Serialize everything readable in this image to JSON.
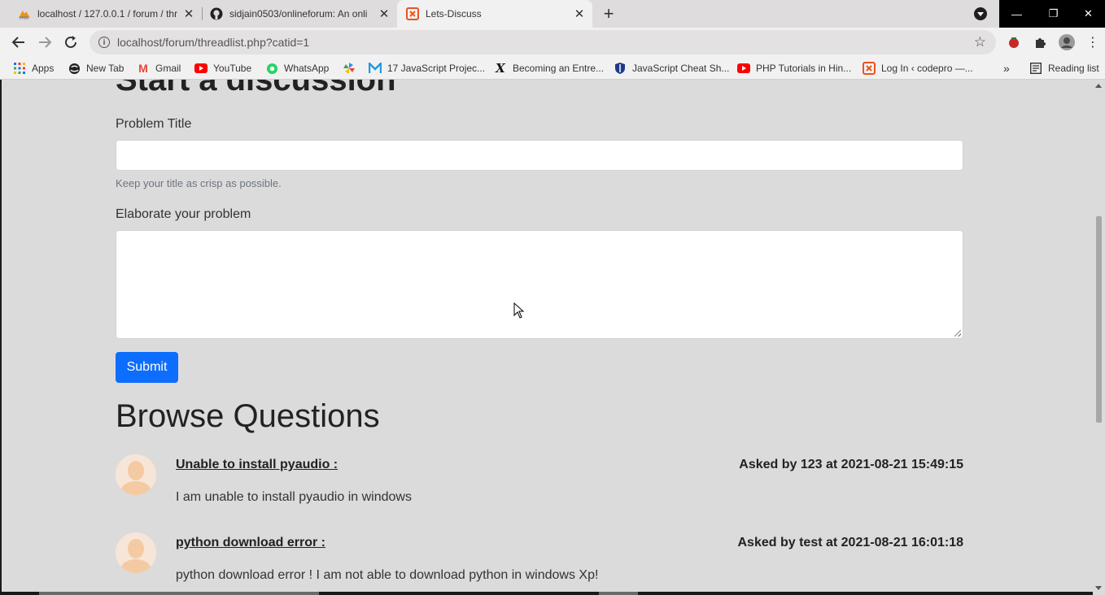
{
  "browser": {
    "tabs": [
      {
        "title": "localhost / 127.0.0.1 / forum / thr",
        "favicon": "phpmyadmin-icon",
        "active": false
      },
      {
        "title": "sidjain0503/onlineforum: An onli",
        "favicon": "github-icon",
        "active": false
      },
      {
        "title": "Lets-Discuss",
        "favicon": "codepro-icon",
        "active": true
      }
    ],
    "new_tab": "+",
    "address": "localhost/forum/threadlist.php?catid=1",
    "bookmarks": [
      {
        "label": "Apps",
        "icon": "apps-grid-icon"
      },
      {
        "label": "New Tab",
        "icon": "globe-icon"
      },
      {
        "label": "Gmail",
        "icon": "gmail-icon"
      },
      {
        "label": "YouTube",
        "icon": "youtube-icon"
      },
      {
        "label": "WhatsApp",
        "icon": "whatsapp-icon"
      },
      {
        "label": "",
        "icon": "pinwheel-icon"
      },
      {
        "label": "17 JavaScript Projec...",
        "icon": "medium-icon"
      },
      {
        "label": "Becoming an Entre...",
        "icon": "x-logo-icon"
      },
      {
        "label": "JavaScript Cheat Sh...",
        "icon": "shield-icon"
      },
      {
        "label": "PHP Tutorials in Hin...",
        "icon": "youtube-icon"
      },
      {
        "label": "Log In ‹ codepro —...",
        "icon": "codepro-icon"
      }
    ],
    "bookmarks_overflow": "»",
    "reading_list": "Reading list"
  },
  "page": {
    "cut_heading": "Start a discussion",
    "form": {
      "title_label": "Problem Title",
      "title_value": "",
      "title_help": "Keep your title as crisp as possible.",
      "desc_label": "Elaborate your problem",
      "desc_value": "",
      "submit_label": "Submit"
    },
    "browse_heading": "Browse Questions",
    "questions": [
      {
        "title": "Unable to install pyaudio :",
        "meta": "Asked by 123 at 2021-08-21 15:49:15",
        "description": "I am unable to install pyaudio in windows"
      },
      {
        "title": "python download error :",
        "meta": "Asked by test at 2021-08-21 16:01:18",
        "description": "python download error ! I am not able to download python in windows Xp!"
      }
    ]
  },
  "colors": {
    "page_bg": "#dcdbdc",
    "submit_bg": "#0d6efd",
    "tabstrip_bg": "#dedcdc",
    "toolbar_bg": "#f2f1f1"
  }
}
